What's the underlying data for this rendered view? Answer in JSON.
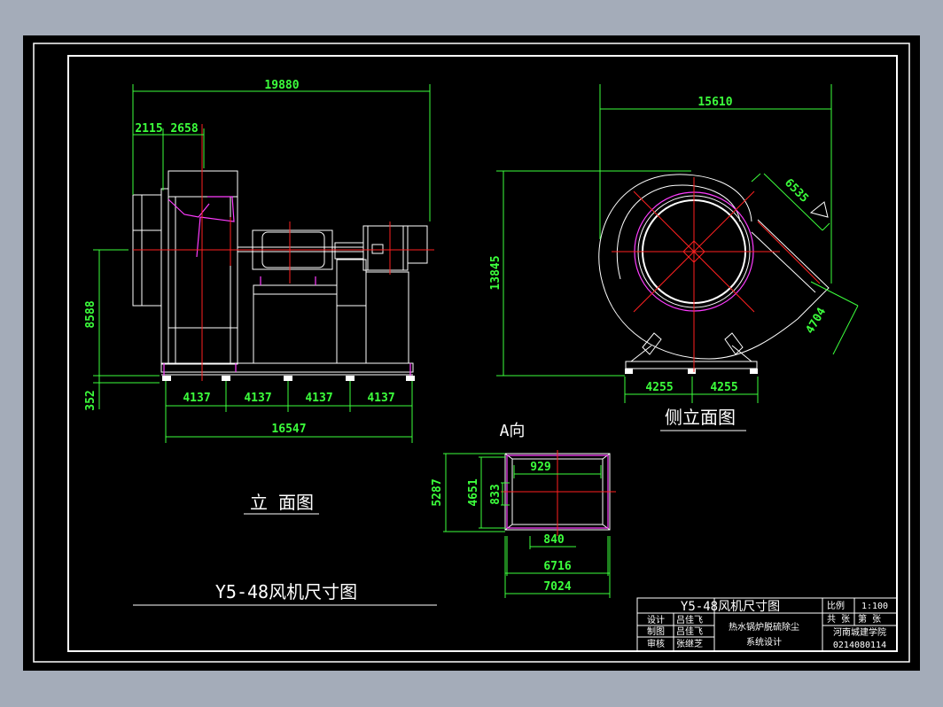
{
  "drawing_title": "Y5-48风机尺寸图",
  "views": {
    "elevation_label": "立 面图",
    "side_label": "侧立面图",
    "view_a_label": "A向"
  },
  "elevation_dims": {
    "overall_top": "19880",
    "left_a": "2115",
    "left_b": "2658",
    "height_main": "8588",
    "height_base": "352",
    "bay1": "4137",
    "bay2": "4137",
    "bay3": "4137",
    "bay4": "4137",
    "overall_bottom": "16547"
  },
  "side_dims": {
    "width_top": "15610",
    "height": "13845",
    "outlet_diag": "6535",
    "outlet_diag2": "4704",
    "foot_left": "4255",
    "foot_right": "4255"
  },
  "view_a_dims": {
    "inner_w": "929",
    "h_outer": "5287",
    "h_mid": "4651",
    "h_small": "833",
    "seg": "840",
    "w_mid": "6716",
    "w_outer": "7024"
  },
  "title_block": {
    "title": "Y5-48风机尺寸图",
    "scale_label": "比例",
    "scale_value": "1:100",
    "sheets_total": "共 张",
    "sheet_no": "第 张",
    "row1_role": "设计",
    "row1_name": "吕佳飞",
    "row2_role": "制图",
    "row2_name": "吕佳飞",
    "row3_role": "审核",
    "row3_name": "张继芝",
    "project_line1": "热水锅炉脱硫除尘",
    "project_line2": "系统设计",
    "school": "河南城建学院",
    "code": "0214080114"
  }
}
